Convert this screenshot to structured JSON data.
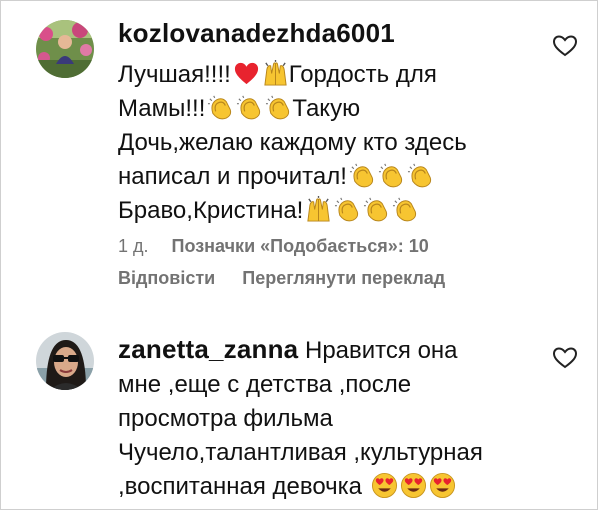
{
  "comments": [
    {
      "username": "kozlovanadezhda6001",
      "lines": [
        [
          {
            "t": "text",
            "v": "Лучшая!!!!"
          },
          {
            "t": "icon",
            "v": "red-heart-icon"
          },
          {
            "t": "icon",
            "v": "praising-hands-icon"
          },
          {
            "t": "text",
            "v": "Гордость для"
          }
        ],
        [
          {
            "t": "text",
            "v": "Мамы!!!"
          },
          {
            "t": "icon",
            "v": "clapping-hands-icon"
          },
          {
            "t": "icon",
            "v": "clapping-hands-icon"
          },
          {
            "t": "icon",
            "v": "clapping-hands-icon"
          },
          {
            "t": "text",
            "v": "Такую"
          }
        ],
        [
          {
            "t": "text",
            "v": "Дочь,желаю каждому кто здесь"
          }
        ],
        [
          {
            "t": "text",
            "v": "написал и прочитал!"
          },
          {
            "t": "icon",
            "v": "clapping-hands-icon"
          },
          {
            "t": "icon",
            "v": "clapping-hands-icon"
          },
          {
            "t": "icon",
            "v": "clapping-hands-icon"
          }
        ],
        [
          {
            "t": "text",
            "v": "Браво,Кристина!"
          },
          {
            "t": "icon",
            "v": "praising-hands-icon"
          },
          {
            "t": "icon",
            "v": "clapping-hands-icon"
          },
          {
            "t": "icon",
            "v": "clapping-hands-icon"
          },
          {
            "t": "icon",
            "v": "clapping-hands-icon"
          }
        ]
      ],
      "time": "1 д.",
      "likes_label": "Позначки «Подобається»: 10",
      "reply_label": "Відповісти",
      "translate_label": "Переглянути переклад",
      "like_icon": "heart-outline-icon"
    },
    {
      "username": "zanetta_zanna",
      "lines": [
        [
          {
            "t": "user",
            "v": "zanetta_zanna"
          },
          {
            "t": "text",
            "v": " Нравится она"
          }
        ],
        [
          {
            "t": "text",
            "v": "мне ,еще с детства ,после"
          }
        ],
        [
          {
            "t": "text",
            "v": "просмотра фильма"
          }
        ],
        [
          {
            "t": "text",
            "v": "Чучело,талантливая ,культурная"
          }
        ],
        [
          {
            "t": "text",
            "v": ",воспитанная девочка "
          },
          {
            "t": "icon",
            "v": "heart-eyes-face-icon"
          },
          {
            "t": "icon",
            "v": "heart-eyes-face-icon"
          },
          {
            "t": "icon",
            "v": "heart-eyes-face-icon"
          }
        ]
      ],
      "like_icon": "heart-outline-icon"
    }
  ],
  "colors": {
    "text": "#111111",
    "meta": "#737373",
    "heart_red": "#e8232e",
    "emoji_yellow": "#f7c531"
  }
}
